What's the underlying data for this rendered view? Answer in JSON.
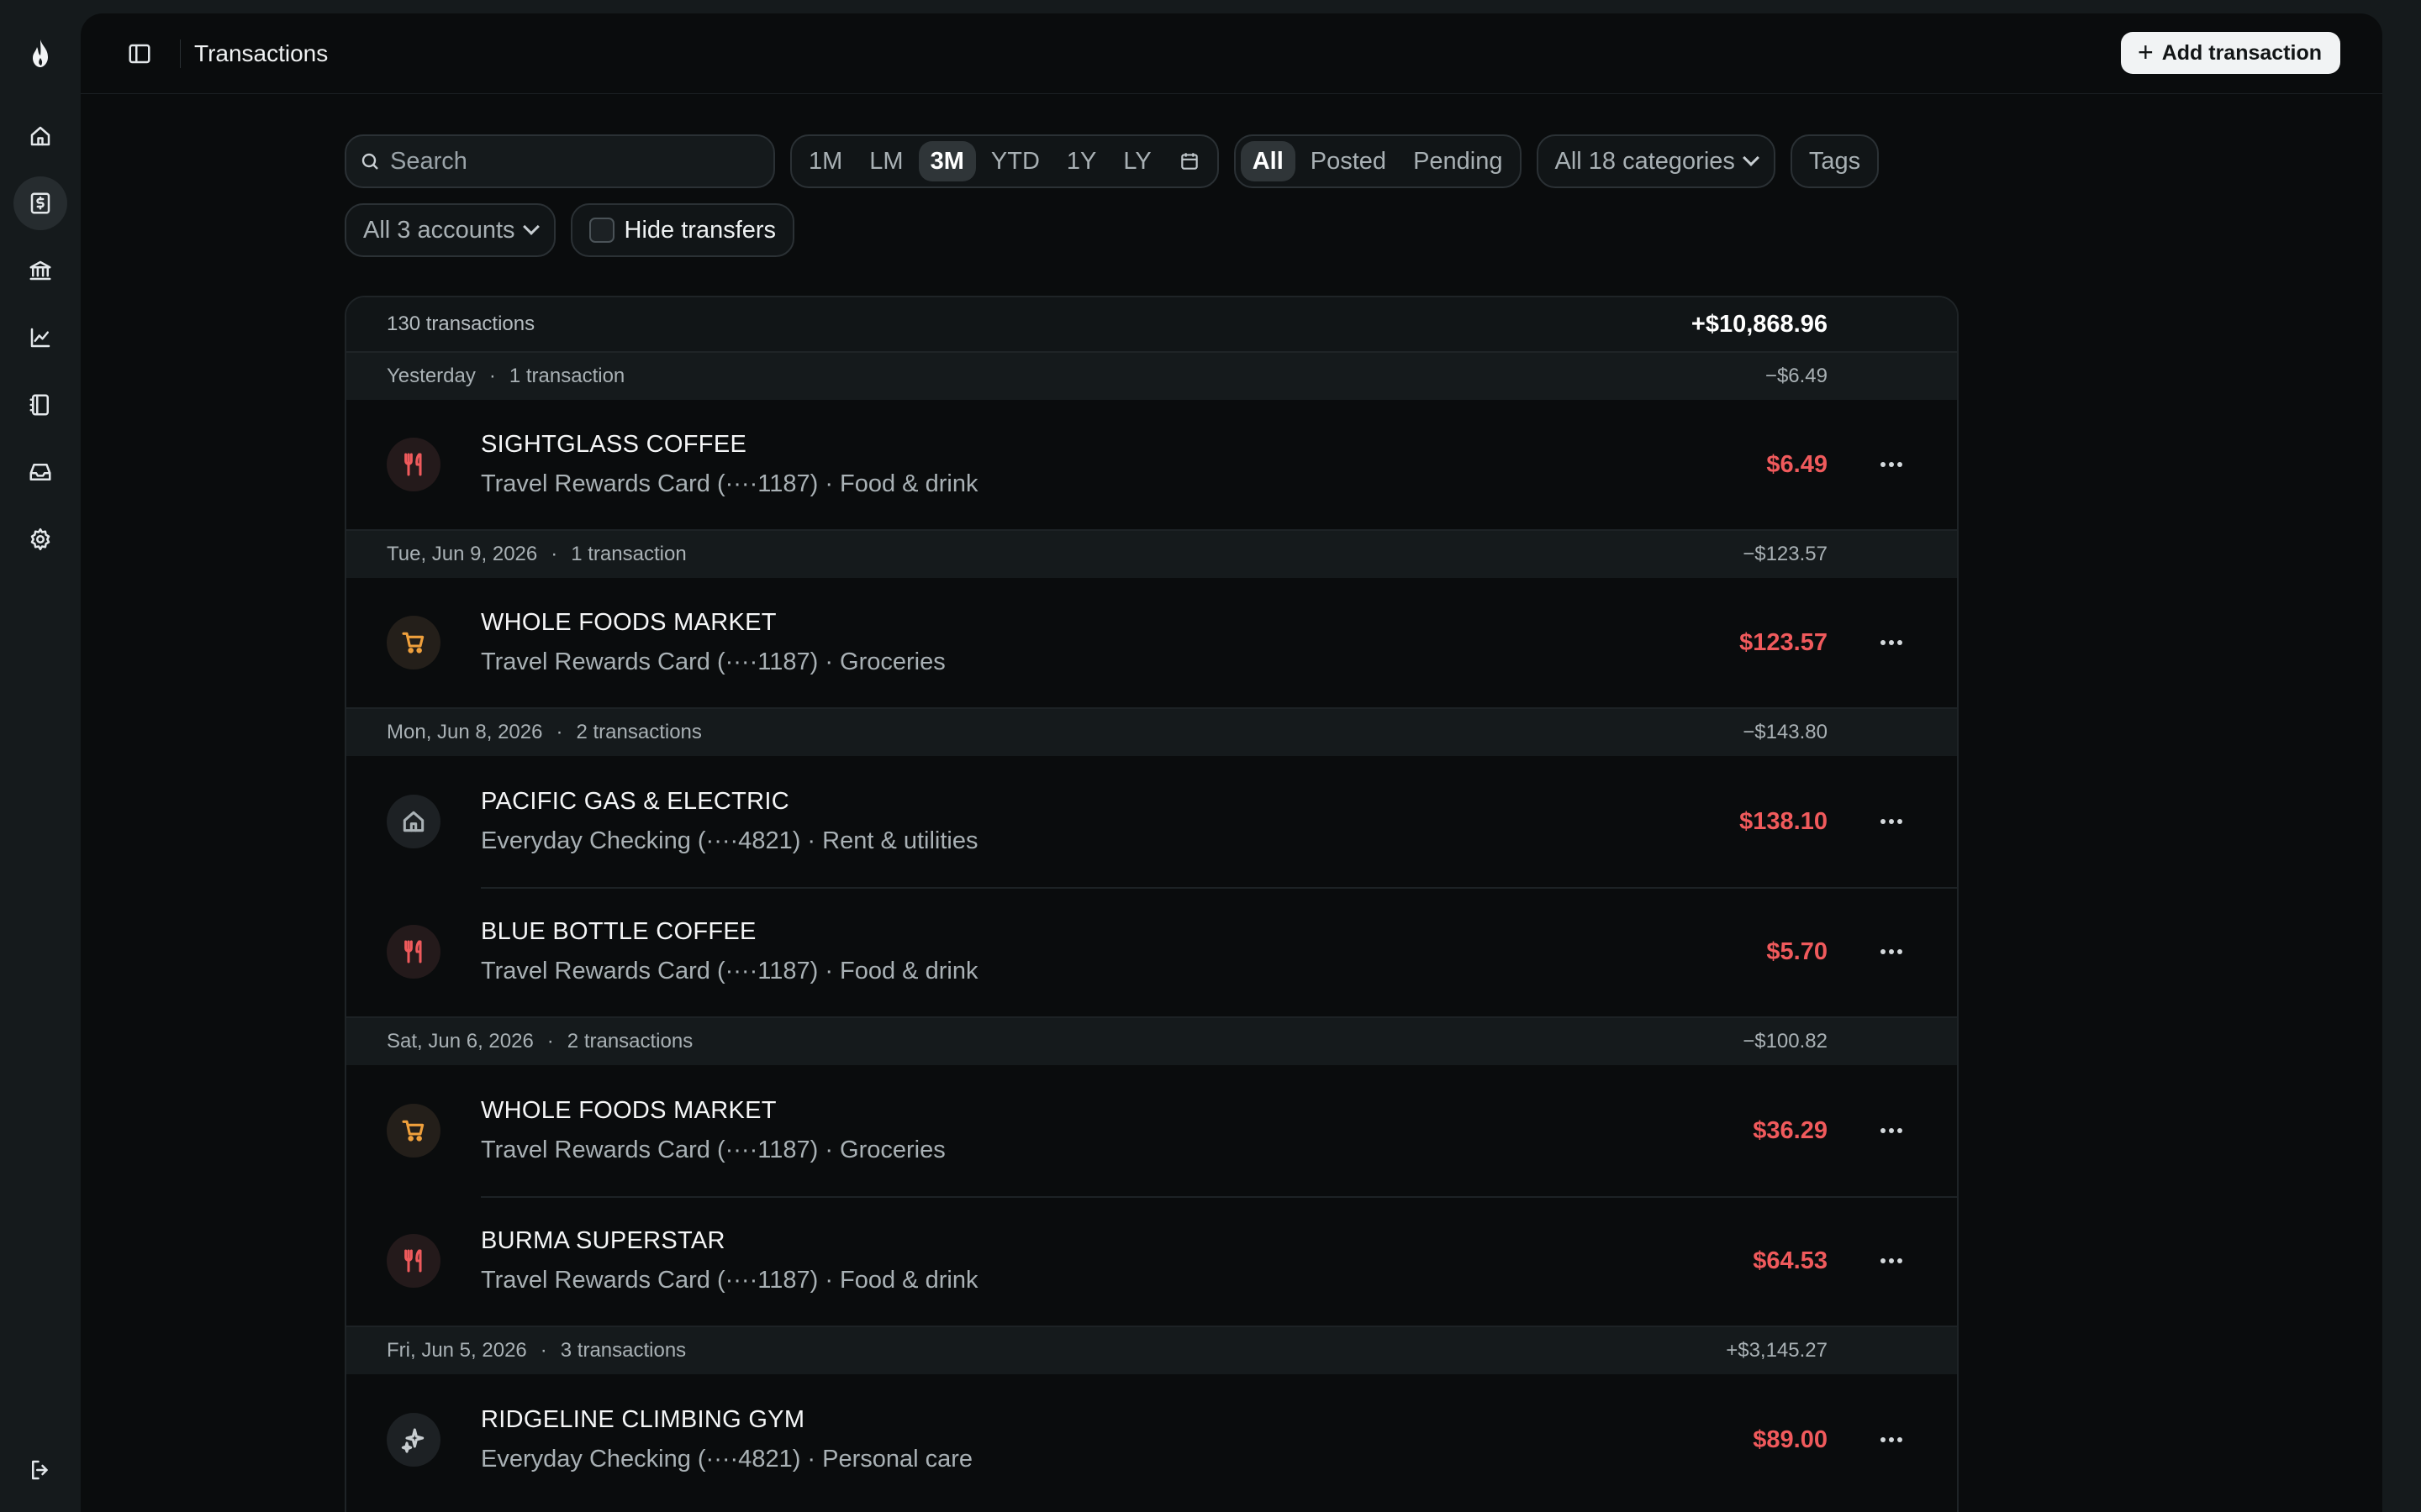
{
  "rail": {
    "items": [
      {
        "name": "home-icon",
        "active": false
      },
      {
        "name": "transactions-icon",
        "active": true
      },
      {
        "name": "accounts-icon",
        "active": false
      },
      {
        "name": "reports-icon",
        "active": false
      },
      {
        "name": "budget-icon",
        "active": false
      },
      {
        "name": "inbox-icon",
        "active": false
      },
      {
        "name": "settings-icon",
        "active": false
      }
    ],
    "logout_icon": "logout-icon"
  },
  "header": {
    "title": "Transactions",
    "add_label": "Add transaction"
  },
  "filters": {
    "search_placeholder": "Search",
    "ranges": [
      "1M",
      "LM",
      "3M",
      "YTD",
      "1Y",
      "LY"
    ],
    "active_range": "3M",
    "statuses": [
      "All",
      "Posted",
      "Pending"
    ],
    "active_status": "All",
    "categories_label": "All 18 categories",
    "tags_label": "Tags",
    "accounts_label": "All 3 accounts",
    "hide_transfers_label": "Hide transfers"
  },
  "summary": {
    "count": "130 transactions",
    "total": "+$10,868.96"
  },
  "groups": [
    {
      "date": "Yesterday",
      "count": "1 transaction",
      "total": "−$6.49",
      "rows": [
        {
          "merchant": "SIGHTGLASS COFFEE",
          "meta": "Travel Rewards Card (····1187) · Food & drink",
          "amount": "$6.49",
          "icon": "fork-knife-icon"
        }
      ]
    },
    {
      "date": "Tue, Jun 9, 2026",
      "count": "1 transaction",
      "total": "−$123.57",
      "rows": [
        {
          "merchant": "WHOLE FOODS MARKET",
          "meta": "Travel Rewards Card (····1187) · Groceries",
          "amount": "$123.57",
          "icon": "cart-icon"
        }
      ]
    },
    {
      "date": "Mon, Jun 8, 2026",
      "count": "2 transactions",
      "total": "−$143.80",
      "rows": [
        {
          "merchant": "PACIFIC GAS & ELECTRIC",
          "meta": "Everyday Checking (····4821) · Rent & utilities",
          "amount": "$138.10",
          "icon": "house-icon"
        },
        {
          "merchant": "BLUE BOTTLE COFFEE",
          "meta": "Travel Rewards Card (····1187) · Food & drink",
          "amount": "$5.70",
          "icon": "fork-knife-icon"
        }
      ]
    },
    {
      "date": "Sat, Jun 6, 2026",
      "count": "2 transactions",
      "total": "−$100.82",
      "rows": [
        {
          "merchant": "WHOLE FOODS MARKET",
          "meta": "Travel Rewards Card (····1187) · Groceries",
          "amount": "$36.29",
          "icon": "cart-icon"
        },
        {
          "merchant": "BURMA SUPERSTAR",
          "meta": "Travel Rewards Card (····1187) · Food & drink",
          "amount": "$64.53",
          "icon": "fork-knife-icon"
        }
      ]
    },
    {
      "date": "Fri, Jun 5, 2026",
      "count": "3 transactions",
      "total": "+$3,145.27",
      "rows": [
        {
          "merchant": "RIDGELINE CLIMBING GYM",
          "meta": "Everyday Checking (····4821) · Personal care",
          "amount": "$89.00",
          "icon": "sparkle-icon"
        }
      ]
    }
  ],
  "colors": {
    "expense": "#f05a5c",
    "food_icon": "#ef5a5c",
    "grocery_icon": "#f0a03c",
    "background": "#0a0c0d"
  }
}
